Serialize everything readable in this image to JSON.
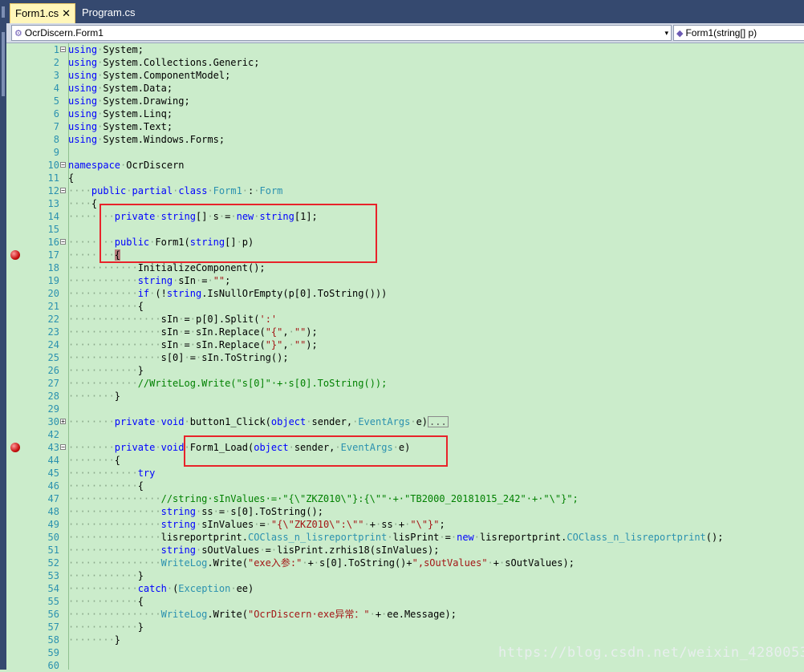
{
  "tabs": [
    {
      "label": "Form1.cs",
      "close_glyph": "✕",
      "active": true
    },
    {
      "label": "Program.cs",
      "active": false
    }
  ],
  "navbar": {
    "class_combo": "OcrDiscern.Form1",
    "member_combo": "Form1(string[] p)",
    "class_icon": "class-icon",
    "member_icon": "method-icon",
    "dropdown_glyph": "▾"
  },
  "editor": {
    "lines": [
      {
        "n": "1",
        "fold": "-",
        "tokens": [
          [
            "kw",
            "using"
          ],
          [
            "ws",
            "·"
          ],
          [
            "",
            "System;"
          ]
        ]
      },
      {
        "n": "2",
        "tokens": [
          [
            "kw",
            "using"
          ],
          [
            "ws",
            "·"
          ],
          [
            "",
            "System.Collections.Generic;"
          ]
        ]
      },
      {
        "n": "3",
        "tokens": [
          [
            "kw",
            "using"
          ],
          [
            "ws",
            "·"
          ],
          [
            "",
            "System.ComponentModel;"
          ]
        ]
      },
      {
        "n": "4",
        "tokens": [
          [
            "kw",
            "using"
          ],
          [
            "ws",
            "·"
          ],
          [
            "",
            "System.Data;"
          ]
        ]
      },
      {
        "n": "5",
        "tokens": [
          [
            "kw",
            "using"
          ],
          [
            "ws",
            "·"
          ],
          [
            "",
            "System.Drawing;"
          ]
        ]
      },
      {
        "n": "6",
        "tokens": [
          [
            "kw",
            "using"
          ],
          [
            "ws",
            "·"
          ],
          [
            "",
            "System.Linq;"
          ]
        ]
      },
      {
        "n": "7",
        "tokens": [
          [
            "kw",
            "using"
          ],
          [
            "ws",
            "·"
          ],
          [
            "",
            "System.Text;"
          ]
        ]
      },
      {
        "n": "8",
        "tokens": [
          [
            "kw",
            "using"
          ],
          [
            "ws",
            "·"
          ],
          [
            "",
            "System.Windows.Forms;"
          ]
        ]
      },
      {
        "n": "9",
        "tokens": []
      },
      {
        "n": "10",
        "fold": "-",
        "tokens": [
          [
            "kw",
            "namespace"
          ],
          [
            "ws",
            "·"
          ],
          [
            "",
            "OcrDiscern"
          ]
        ]
      },
      {
        "n": "11",
        "tokens": [
          [
            "",
            "{"
          ]
        ]
      },
      {
        "n": "12",
        "fold": "-",
        "tokens": [
          [
            "ws",
            "····"
          ],
          [
            "kw",
            "public"
          ],
          [
            "ws",
            "·"
          ],
          [
            "kw",
            "partial"
          ],
          [
            "ws",
            "·"
          ],
          [
            "kw",
            "class"
          ],
          [
            "ws",
            "·"
          ],
          [
            "ty",
            "Form1"
          ],
          [
            "ws",
            "·"
          ],
          [
            "",
            ":"
          ],
          [
            "ws",
            "·"
          ],
          [
            "ty",
            "Form"
          ]
        ]
      },
      {
        "n": "13",
        "tokens": [
          [
            "ws",
            "····"
          ],
          [
            "",
            "{"
          ]
        ]
      },
      {
        "n": "14",
        "tokens": [
          [
            "ws",
            "········"
          ],
          [
            "kw",
            "private"
          ],
          [
            "ws",
            "·"
          ],
          [
            "kw",
            "string"
          ],
          [
            "",
            "[]"
          ],
          [
            "ws",
            "·"
          ],
          [
            "",
            "s"
          ],
          [
            "ws",
            "·"
          ],
          [
            "",
            "="
          ],
          [
            "ws",
            "·"
          ],
          [
            "kw",
            "new"
          ],
          [
            "ws",
            "·"
          ],
          [
            "kw",
            "string"
          ],
          [
            "",
            "[1];"
          ]
        ]
      },
      {
        "n": "15",
        "tokens": []
      },
      {
        "n": "16",
        "fold": "-",
        "tokens": [
          [
            "ws",
            "········"
          ],
          [
            "kw",
            "public"
          ],
          [
            "ws",
            "·"
          ],
          [
            "",
            "Form1("
          ],
          [
            "kw",
            "string"
          ],
          [
            "",
            "[]"
          ],
          [
            "ws",
            "·"
          ],
          [
            "",
            "p)"
          ]
        ]
      },
      {
        "n": "17",
        "bp": true,
        "tokens": [
          [
            "ws",
            "········"
          ],
          [
            "brace",
            "{"
          ]
        ]
      },
      {
        "n": "18",
        "tokens": [
          [
            "ws",
            "············"
          ],
          [
            "",
            "InitializeComponent();"
          ]
        ]
      },
      {
        "n": "19",
        "tokens": [
          [
            "ws",
            "············"
          ],
          [
            "kw",
            "string"
          ],
          [
            "ws",
            "·"
          ],
          [
            "",
            "sIn"
          ],
          [
            "ws",
            "·"
          ],
          [
            "",
            "="
          ],
          [
            "ws",
            "·"
          ],
          [
            "str",
            "\"\""
          ],
          [
            "",
            ";"
          ]
        ]
      },
      {
        "n": "20",
        "tokens": [
          [
            "ws",
            "············"
          ],
          [
            "kw",
            "if"
          ],
          [
            "ws",
            "·"
          ],
          [
            "",
            "(!"
          ],
          [
            "kw",
            "string"
          ],
          [
            "",
            ".IsNullOrEmpty(p[0].ToString()))"
          ]
        ]
      },
      {
        "n": "21",
        "tokens": [
          [
            "ws",
            "············"
          ],
          [
            "",
            "{"
          ]
        ]
      },
      {
        "n": "22",
        "tokens": [
          [
            "ws",
            "················"
          ],
          [
            "",
            "sIn"
          ],
          [
            "ws",
            "·"
          ],
          [
            "",
            "="
          ],
          [
            "ws",
            "·"
          ],
          [
            "",
            "p[0].Split("
          ],
          [
            "str",
            "':'"
          ],
          [
            ")[1].ToString();",
            ""
          ]
        ]
      },
      {
        "n": "23",
        "tokens": [
          [
            "ws",
            "················"
          ],
          [
            "",
            "sIn"
          ],
          [
            "ws",
            "·"
          ],
          [
            "",
            "="
          ],
          [
            "ws",
            "·"
          ],
          [
            "",
            "sIn.Replace("
          ],
          [
            "str",
            "\"{\""
          ],
          [
            "",
            ","
          ],
          [
            "ws",
            "·"
          ],
          [
            "str",
            "\"\""
          ],
          [
            "",
            ");"
          ]
        ]
      },
      {
        "n": "24",
        "tokens": [
          [
            "ws",
            "················"
          ],
          [
            "",
            "sIn"
          ],
          [
            "ws",
            "·"
          ],
          [
            "",
            "="
          ],
          [
            "ws",
            "·"
          ],
          [
            "",
            "sIn.Replace("
          ],
          [
            "str",
            "\"}\""
          ],
          [
            "",
            ","
          ],
          [
            "ws",
            "·"
          ],
          [
            "str",
            "\"\""
          ],
          [
            "",
            ");"
          ]
        ]
      },
      {
        "n": "25",
        "tokens": [
          [
            "ws",
            "················"
          ],
          [
            "",
            "s[0]"
          ],
          [
            "ws",
            "·"
          ],
          [
            "",
            "="
          ],
          [
            "ws",
            "·"
          ],
          [
            "",
            "sIn.ToString();"
          ]
        ]
      },
      {
        "n": "26",
        "tokens": [
          [
            "ws",
            "············"
          ],
          [
            "",
            "}"
          ]
        ]
      },
      {
        "n": "27",
        "tokens": [
          [
            "ws",
            "············"
          ],
          [
            "cm",
            "//WriteLog.Write(\"s[0]\"·+·s[0].ToString());"
          ]
        ]
      },
      {
        "n": "28",
        "tokens": [
          [
            "ws",
            "········"
          ],
          [
            "",
            "}"
          ]
        ]
      },
      {
        "n": "29",
        "tokens": []
      },
      {
        "n": "30",
        "fold": "+",
        "tokens": [
          [
            "ws",
            "········"
          ],
          [
            "kw",
            "private"
          ],
          [
            "ws",
            "·"
          ],
          [
            "kw",
            "void"
          ],
          [
            "ws",
            "·"
          ],
          [
            "",
            "button1_Click("
          ],
          [
            "kw",
            "object"
          ],
          [
            "ws",
            "·"
          ],
          [
            "",
            "sender,"
          ],
          [
            "ws",
            "·"
          ],
          [
            "ty",
            "EventArgs"
          ],
          [
            "ws",
            "·"
          ],
          [
            "",
            "e)"
          ],
          [
            "collapsed",
            "..."
          ]
        ]
      },
      {
        "n": "42",
        "tokens": []
      },
      {
        "n": "43",
        "fold": "-",
        "bp": true,
        "tokens": [
          [
            "ws",
            "········"
          ],
          [
            "kw",
            "private"
          ],
          [
            "ws",
            "·"
          ],
          [
            "kw",
            "void"
          ],
          [
            "ws",
            "·"
          ],
          [
            "",
            "Form1_Load("
          ],
          [
            "kw",
            "object"
          ],
          [
            "ws",
            "·"
          ],
          [
            "",
            "sender,"
          ],
          [
            "ws",
            "·"
          ],
          [
            "ty",
            "EventArgs"
          ],
          [
            "ws",
            "·"
          ],
          [
            "",
            "e)"
          ]
        ]
      },
      {
        "n": "44",
        "tokens": [
          [
            "ws",
            "········"
          ],
          [
            "",
            "{"
          ]
        ]
      },
      {
        "n": "45",
        "tokens": [
          [
            "ws",
            "············"
          ],
          [
            "kw",
            "try"
          ]
        ]
      },
      {
        "n": "46",
        "tokens": [
          [
            "ws",
            "············"
          ],
          [
            "",
            "{"
          ]
        ]
      },
      {
        "n": "47",
        "tokens": [
          [
            "ws",
            "················"
          ],
          [
            "cm",
            "//string·sInValues·=·\"{\\\"ZKZ010\\\"}:{\\\"\"·+·\"TB2000_20181015_242\"·+·\"\\\"}\";"
          ]
        ]
      },
      {
        "n": "48",
        "tokens": [
          [
            "ws",
            "················"
          ],
          [
            "kw",
            "string"
          ],
          [
            "ws",
            "·"
          ],
          [
            "",
            "ss"
          ],
          [
            "ws",
            "·"
          ],
          [
            "",
            "="
          ],
          [
            "ws",
            "·"
          ],
          [
            "",
            "s[0].ToString();"
          ]
        ]
      },
      {
        "n": "49",
        "tokens": [
          [
            "ws",
            "················"
          ],
          [
            "kw",
            "string"
          ],
          [
            "ws",
            "·"
          ],
          [
            "",
            "sInValues"
          ],
          [
            "ws",
            "·"
          ],
          [
            "",
            "="
          ],
          [
            "ws",
            "·"
          ],
          [
            "str",
            "\"{\\\"ZKZ010\\\":\\\"\""
          ],
          [
            "ws",
            "·"
          ],
          [
            "",
            "+"
          ],
          [
            "ws",
            "·"
          ],
          [
            "",
            "ss"
          ],
          [
            "ws",
            "·"
          ],
          [
            "",
            "+"
          ],
          [
            "ws",
            "·"
          ],
          [
            "str",
            "\"\\\"}\""
          ],
          [
            "",
            ";"
          ]
        ]
      },
      {
        "n": "50",
        "tokens": [
          [
            "ws",
            "················"
          ],
          [
            "",
            "lisreportprint."
          ],
          [
            "ty",
            "COClass_n_lisreportprint"
          ],
          [
            "ws",
            "·"
          ],
          [
            "",
            "lisPrint"
          ],
          [
            "ws",
            "·"
          ],
          [
            "",
            "="
          ],
          [
            "ws",
            "·"
          ],
          [
            "kw",
            "new"
          ],
          [
            "ws",
            "·"
          ],
          [
            "",
            "lisreportprint."
          ],
          [
            "ty",
            "COClass_n_lisreportprint"
          ],
          [
            "",
            "();"
          ]
        ]
      },
      {
        "n": "51",
        "tokens": [
          [
            "ws",
            "················"
          ],
          [
            "kw",
            "string"
          ],
          [
            "ws",
            "·"
          ],
          [
            "",
            "sOutValues"
          ],
          [
            "ws",
            "·"
          ],
          [
            "",
            "="
          ],
          [
            "ws",
            "·"
          ],
          [
            "",
            "lisPrint.zrhis18(sInValues);"
          ]
        ]
      },
      {
        "n": "52",
        "tokens": [
          [
            "ws",
            "················"
          ],
          [
            "ty",
            "WriteLog"
          ],
          [
            "",
            ".Write("
          ],
          [
            "str",
            "\"exe入参:\""
          ],
          [
            "ws",
            "·"
          ],
          [
            "",
            "+"
          ],
          [
            "ws",
            "·"
          ],
          [
            "",
            "s[0].ToString()+"
          ],
          [
            "str",
            "\",sOutValues\""
          ],
          [
            "ws",
            "·"
          ],
          [
            "",
            "+"
          ],
          [
            "ws",
            "·"
          ],
          [
            "",
            "sOutValues);"
          ]
        ]
      },
      {
        "n": "53",
        "tokens": [
          [
            "ws",
            "············"
          ],
          [
            "",
            "}"
          ]
        ]
      },
      {
        "n": "54",
        "tokens": [
          [
            "ws",
            "············"
          ],
          [
            "kw",
            "catch"
          ],
          [
            "ws",
            "·"
          ],
          [
            "",
            "("
          ],
          [
            "ty",
            "Exception"
          ],
          [
            "ws",
            "·"
          ],
          [
            "",
            "ee)"
          ]
        ]
      },
      {
        "n": "55",
        "tokens": [
          [
            "ws",
            "············"
          ],
          [
            "",
            "{"
          ]
        ]
      },
      {
        "n": "56",
        "tokens": [
          [
            "ws",
            "················"
          ],
          [
            "ty",
            "WriteLog"
          ],
          [
            "",
            ".Write("
          ],
          [
            "str",
            "\"OcrDiscern·exe异常：\""
          ],
          [
            "ws",
            "·"
          ],
          [
            "",
            "+"
          ],
          [
            "ws",
            "·"
          ],
          [
            "",
            "ee.Message);"
          ]
        ]
      },
      {
        "n": "57",
        "tokens": [
          [
            "ws",
            "············"
          ],
          [
            "",
            "}"
          ]
        ]
      },
      {
        "n": "58",
        "tokens": [
          [
            "ws",
            "········"
          ],
          [
            "",
            "}"
          ]
        ]
      },
      {
        "n": "59",
        "tokens": []
      },
      {
        "n": "60",
        "tokens": []
      }
    ]
  },
  "watermark": "https://blog.csdn.net/weixin_42800530",
  "colors": {
    "background": "#cbeccb",
    "keyword": "#0000ff",
    "type": "#2b91af",
    "string": "#a31515",
    "comment": "#008000",
    "annotation_box": "#e8232a"
  }
}
